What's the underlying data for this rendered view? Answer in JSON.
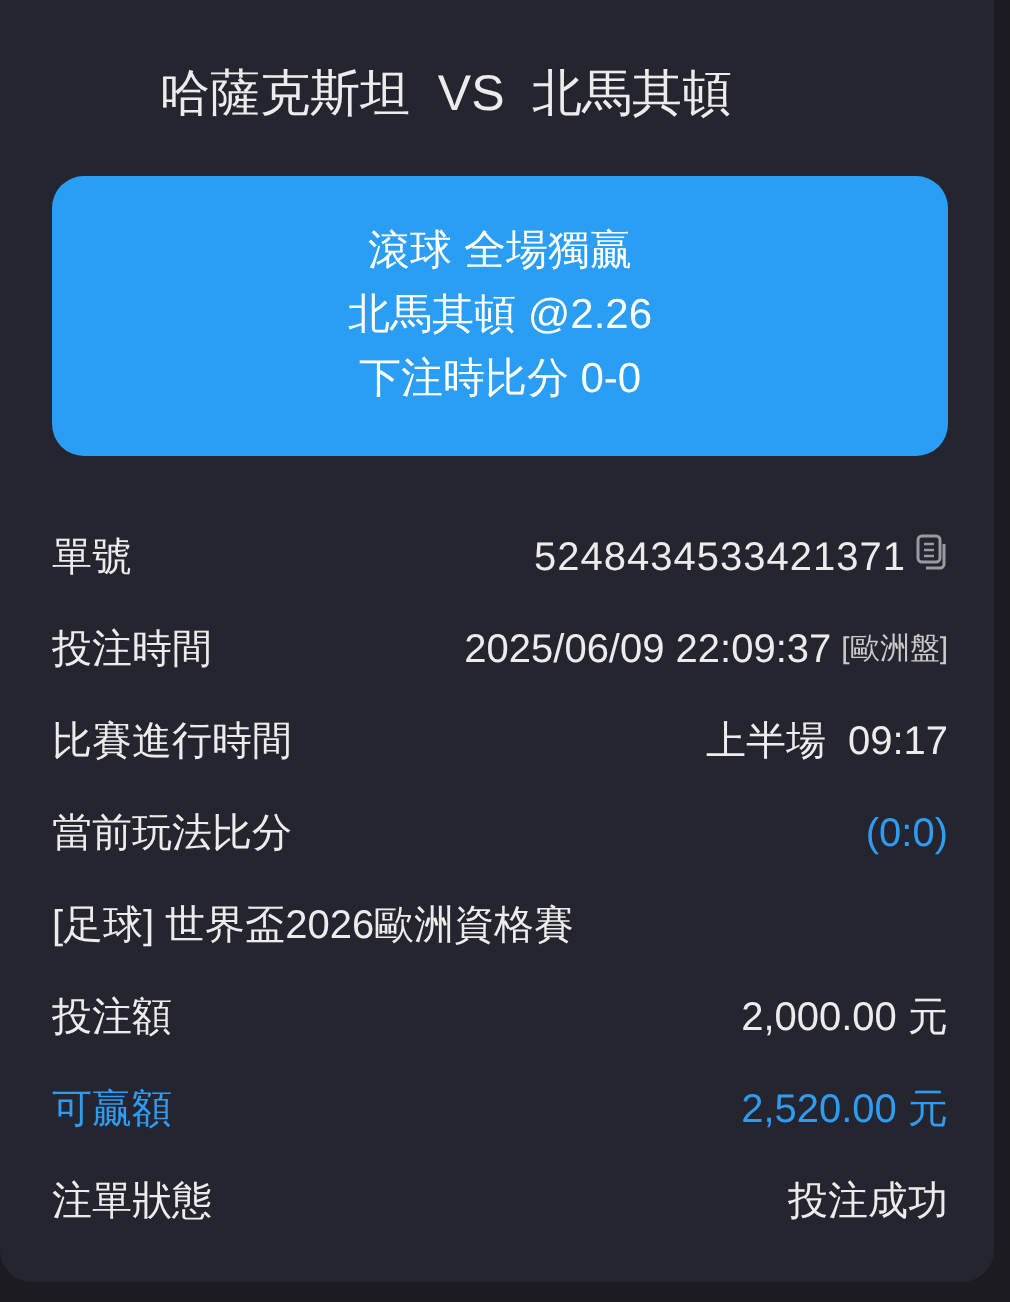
{
  "match_title": "哈薩克斯坦  VS  北馬其頓",
  "bet_card": {
    "lines": [
      "滾球 全場獨贏",
      "北馬其頓 @2.26",
      "下注時比分 0-0"
    ]
  },
  "rows": [
    {
      "kind": "copy",
      "label": "單號",
      "value": "5248434533421371"
    },
    {
      "kind": "tagged",
      "label": "投注時間",
      "value": "2025/06/09 22:09:37",
      "tag": "[歐洲盤]"
    },
    {
      "kind": "plain",
      "label": "比賽進行時間",
      "value": "上半場  09:17"
    },
    {
      "kind": "score",
      "label": "當前玩法比分",
      "value": "(0:0)"
    },
    {
      "kind": "league",
      "label": "[足球] 世界盃2026歐洲資格賽"
    },
    {
      "kind": "plain",
      "label": "投注額",
      "value": "2,000.00 元"
    },
    {
      "kind": "total",
      "label": "可贏額",
      "value": "2,520.00 元"
    },
    {
      "kind": "plain",
      "label": "注單狀態",
      "value": "投注成功"
    }
  ]
}
